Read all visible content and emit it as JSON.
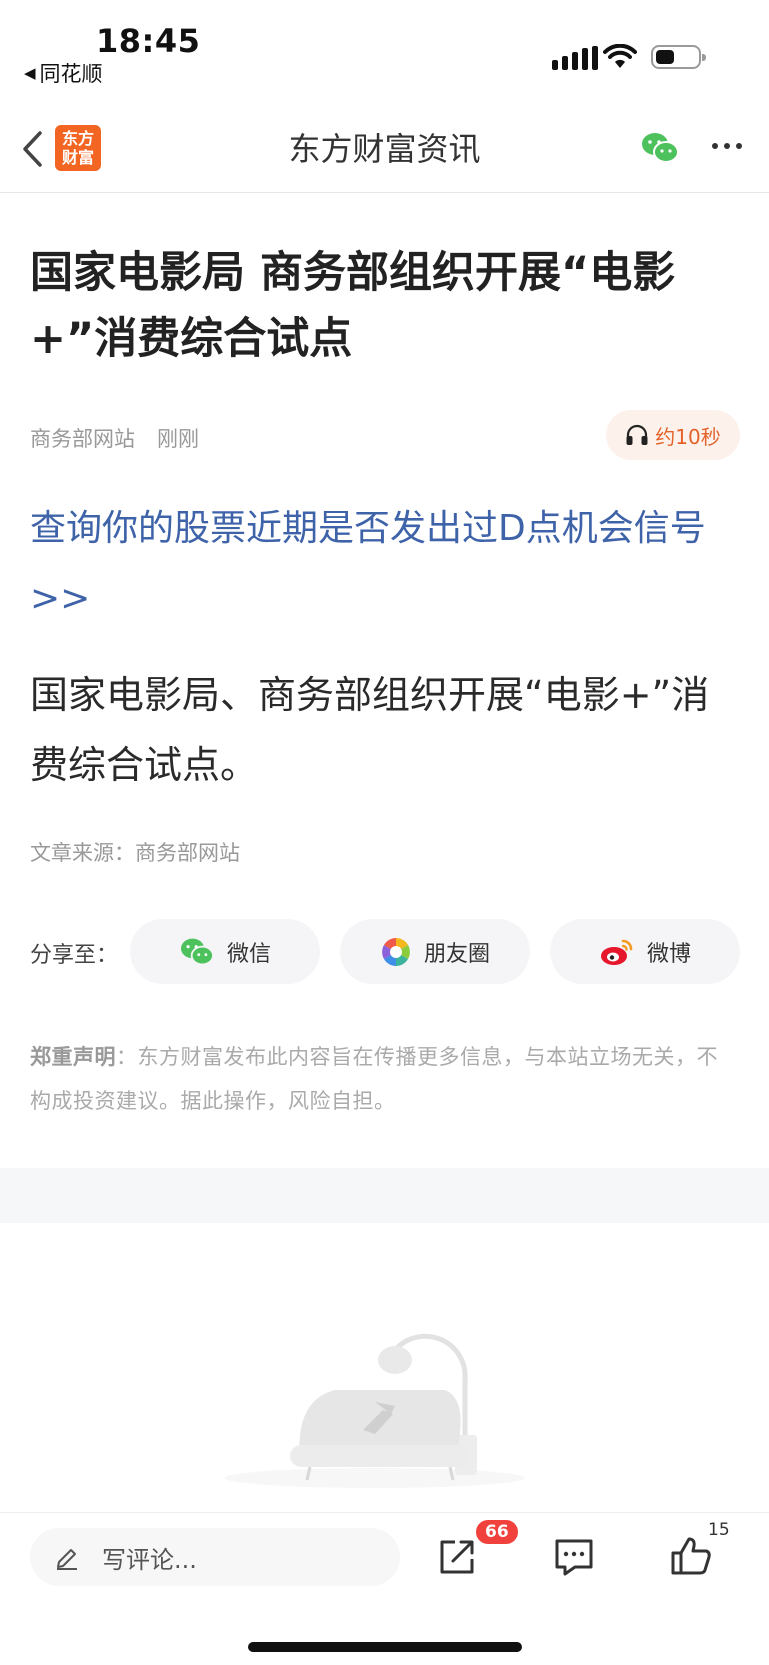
{
  "status_bar": {
    "time": "18:45",
    "back_app": "同花顺"
  },
  "nav": {
    "logo_line1": "东方",
    "logo_line2": "财富",
    "title": "东方财富资讯"
  },
  "article": {
    "headline": "国家电影局 商务部组织开展“电影+”消费综合试点",
    "source": "商务部网站",
    "time": "刚刚",
    "listen_label": "约10秒",
    "promo_link": "查询你的股票近期是否发出过D点机会信号>>",
    "body": "国家电影局、商务部组织开展“电影+”消费综合试点。",
    "source_line": "文章来源：商务部网站"
  },
  "share": {
    "label": "分享至：",
    "wechat": "微信",
    "moments": "朋友圈",
    "weibo": "微博"
  },
  "disclaimer": {
    "title": "郑重声明",
    "text": "：东方财富发布此内容旨在传播更多信息，与本站立场无关，不构成投资建议。据此操作，风险自担。"
  },
  "bottom_bar": {
    "comment_placeholder": "写评论...",
    "share_badge": "66",
    "like_count": "15"
  },
  "colors": {
    "accent": "#f26522",
    "link": "#3f63a9",
    "badge": "#f0413c"
  }
}
